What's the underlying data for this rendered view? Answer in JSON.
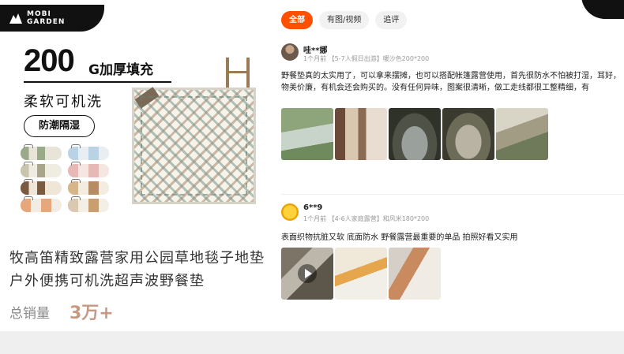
{
  "product": {
    "brand_line1": "MOBI",
    "brand_line2": "GARDEN",
    "hero_number": "200",
    "hero_unit": "G加厚填充",
    "feature_1": "柔软可机洗",
    "feature_2": "防潮隔湿",
    "title": "牧高笛精致露营家用公园草地毯子地垫户外便携可机洗超声波野餐垫",
    "sales_label": "总销量",
    "sales_value": "3万+"
  },
  "filters": [
    {
      "label": "全部",
      "active": true
    },
    {
      "label": "有图/视频",
      "active": false
    },
    {
      "label": "追评",
      "active": false
    }
  ],
  "reviews": [
    {
      "user": "哇**娜",
      "meta": "1个月前  【5-7人假日出游】暖沙色200*200",
      "text": "野餐垫真的太实用了，可以拿来摆摊，也可以搭配帐篷露营使用，首先很防水不怕被打湿，耳好，物美价廉，有机会还会购买的。没有任何异味，图案很清晰，做工走线都很工整精细，有",
      "photo_count": 5,
      "has_video": false
    },
    {
      "user": "6**9",
      "meta": "1个月前  【4-6人家庭露营】和风米180*200",
      "text": "表面织物抗脏又软  底面防水  野餐露营最重要的单品  拍照好看又实用",
      "photo_count": 3,
      "has_video": true
    }
  ],
  "colors": {
    "accent": "#ff5000",
    "sales": "#c49a82"
  }
}
